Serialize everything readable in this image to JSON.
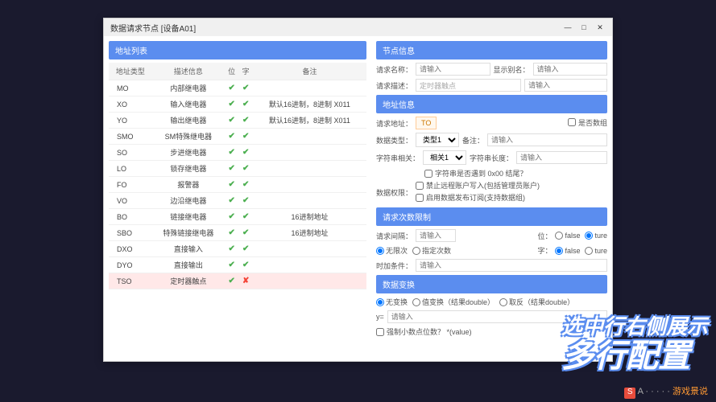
{
  "window": {
    "title": "数据请求节点 [设备A01]"
  },
  "leftPanel": {
    "header": "地址列表",
    "columns": [
      "地址类型",
      "描述信息",
      "位",
      "字",
      "备注"
    ],
    "rows": [
      {
        "type": "MO",
        "desc": "内部继电器",
        "bit": true,
        "word": true,
        "note": ""
      },
      {
        "type": "XO",
        "desc": "输入继电器",
        "bit": true,
        "word": true,
        "note": "默认16进制，8进制 X011"
      },
      {
        "type": "YO",
        "desc": "输出继电器",
        "bit": true,
        "word": true,
        "note": "默认16进制，8进制 X011"
      },
      {
        "type": "SMO",
        "desc": "SM特殊继电器",
        "bit": true,
        "word": true,
        "note": ""
      },
      {
        "type": "SO",
        "desc": "步进继电器",
        "bit": true,
        "word": true,
        "note": ""
      },
      {
        "type": "LO",
        "desc": "锁存继电器",
        "bit": true,
        "word": true,
        "note": ""
      },
      {
        "type": "FO",
        "desc": "报警器",
        "bit": true,
        "word": true,
        "note": ""
      },
      {
        "type": "VO",
        "desc": "边沿继电器",
        "bit": true,
        "word": true,
        "note": ""
      },
      {
        "type": "BO",
        "desc": "链接继电器",
        "bit": true,
        "word": true,
        "note": "16进制地址"
      },
      {
        "type": "SBO",
        "desc": "特殊链接继电器",
        "bit": true,
        "word": true,
        "note": "16进制地址"
      },
      {
        "type": "DXO",
        "desc": "直接输入",
        "bit": true,
        "word": true,
        "note": ""
      },
      {
        "type": "DYO",
        "desc": "直接输出",
        "bit": true,
        "word": true,
        "note": ""
      },
      {
        "type": "TSO",
        "desc": "定时器触点",
        "bit": true,
        "word": false,
        "note": "",
        "selected": true
      }
    ]
  },
  "rightPanel": {
    "nodeInfo": {
      "header": "节点信息",
      "reqNameLabel": "请求名称：",
      "reqNamePlaceholder": "请输入",
      "dispNameLabel": "显示别名：",
      "dispNamePlaceholder": "请输入",
      "reqDescLabel": "请求描述：",
      "reqDescValue": "定时器触点",
      "placeholderGeneric": "请输入"
    },
    "addrInfo": {
      "header": "地址信息",
      "reqAddrLabel": "请求地址：",
      "reqAddrValue": "TO",
      "isArrayLabel": "是否数组",
      "dataTypeLabel": "数据类型：",
      "dataTypeValue": "类型1",
      "noteLabel": "备注：",
      "notePlaceholder": "请输入",
      "strRelLabel": "字符串相关：",
      "strRelValue": "相关1",
      "strLenLabel": "字符串长度：",
      "strLenPlaceholder": "请输入",
      "check1": "字符串是否遇到 0x00 结尾？",
      "permLabel": "数据权限：",
      "check2": "禁止远程账户写入(包括管理员账户)",
      "check3": "启用数据发布订阅(支持数据组)"
    },
    "reqLimit": {
      "header": "请求次数限制",
      "intervalLabel": "请求间隔：",
      "intervalPlaceholder": "请输入",
      "bitLabel": "位：",
      "falseLabel": "false",
      "tureLabel": "ture",
      "noLimitLabel": "无限次",
      "fixedLabel": "指定次数",
      "wordLabel": "字：",
      "timeCondLabel": "时加条件：",
      "timeCondPlaceholder": "请输入"
    },
    "dataConv": {
      "header": "数据变换",
      "noConvLabel": "无变换",
      "valConvLabel": "值变换（结果double）",
      "invConvLabel": "取反（结果double）",
      "yLabel": "y=",
      "yPlaceholder": "请输入",
      "forceDecLabel": "强制小数点位数？ *(value)"
    }
  },
  "annotation": {
    "line1": "选中行右侧展示",
    "line2": "多行配置"
  },
  "watermark": {
    "text": "游戏景说"
  }
}
